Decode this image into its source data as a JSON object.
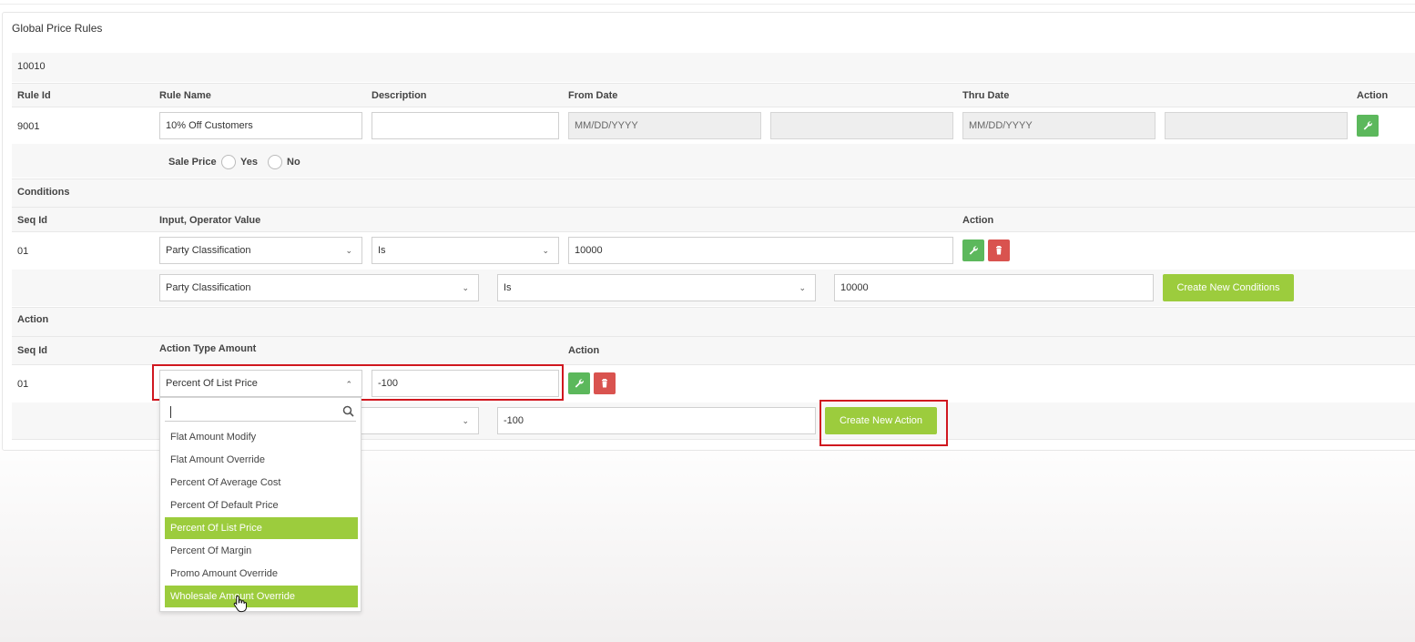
{
  "panel": {
    "title": "Global Price Rules",
    "rule_group_id": "10010"
  },
  "rule_header": {
    "rule_id": "Rule Id",
    "rule_name": "Rule Name",
    "description": "Description",
    "from_date": "From Date",
    "thru_date": "Thru Date",
    "action": "Action"
  },
  "rule_row": {
    "rule_id": "9001",
    "rule_name": "10% Off Customers",
    "description": "",
    "from_date_placeholder": "MM/DD/YYYY",
    "from_time": "",
    "thru_date_placeholder": "MM/DD/YYYY",
    "thru_time": ""
  },
  "sale_price": {
    "label": "Sale Price",
    "yes": "Yes",
    "no": "No"
  },
  "conditions": {
    "title": "Conditions",
    "header": {
      "seq_id": "Seq Id",
      "input_operator_value": "Input, Operator Value",
      "action": "Action"
    },
    "row": {
      "seq_id": "01",
      "input": "Party Classification",
      "operator": "Is",
      "value": "10000"
    },
    "new_row": {
      "input": "Party Classification",
      "operator": "Is",
      "value": "10000",
      "button": "Create New Conditions"
    }
  },
  "action_section": {
    "title": "Action",
    "header": {
      "seq_id": "Seq Id",
      "action_type_amount": "Action Type Amount",
      "action": "Action"
    },
    "row": {
      "seq_id": "01",
      "type": "Percent Of List Price",
      "amount": "-100"
    },
    "new_row": {
      "amount": "-100",
      "button": "Create New Action"
    }
  },
  "dropdown": {
    "search_value": "",
    "options": [
      "Flat Amount Modify",
      "Flat Amount Override",
      "Percent Of Average Cost",
      "Percent Of Default Price",
      "Percent Of List Price",
      "Percent Of Margin",
      "Promo Amount Override",
      "Wholesale Amount Override"
    ],
    "selected": "Percent Of List Price",
    "hovered": "Wholesale Amount Override"
  },
  "colors": {
    "accent": "#9ccc3d",
    "edit": "#5cb85c",
    "delete": "#d9534f",
    "highlight_box": "#d0171f"
  },
  "icons": {
    "edit": "wrench-icon",
    "delete": "trash-icon",
    "search": "search-icon",
    "cursor": "hand-pointer-icon"
  }
}
